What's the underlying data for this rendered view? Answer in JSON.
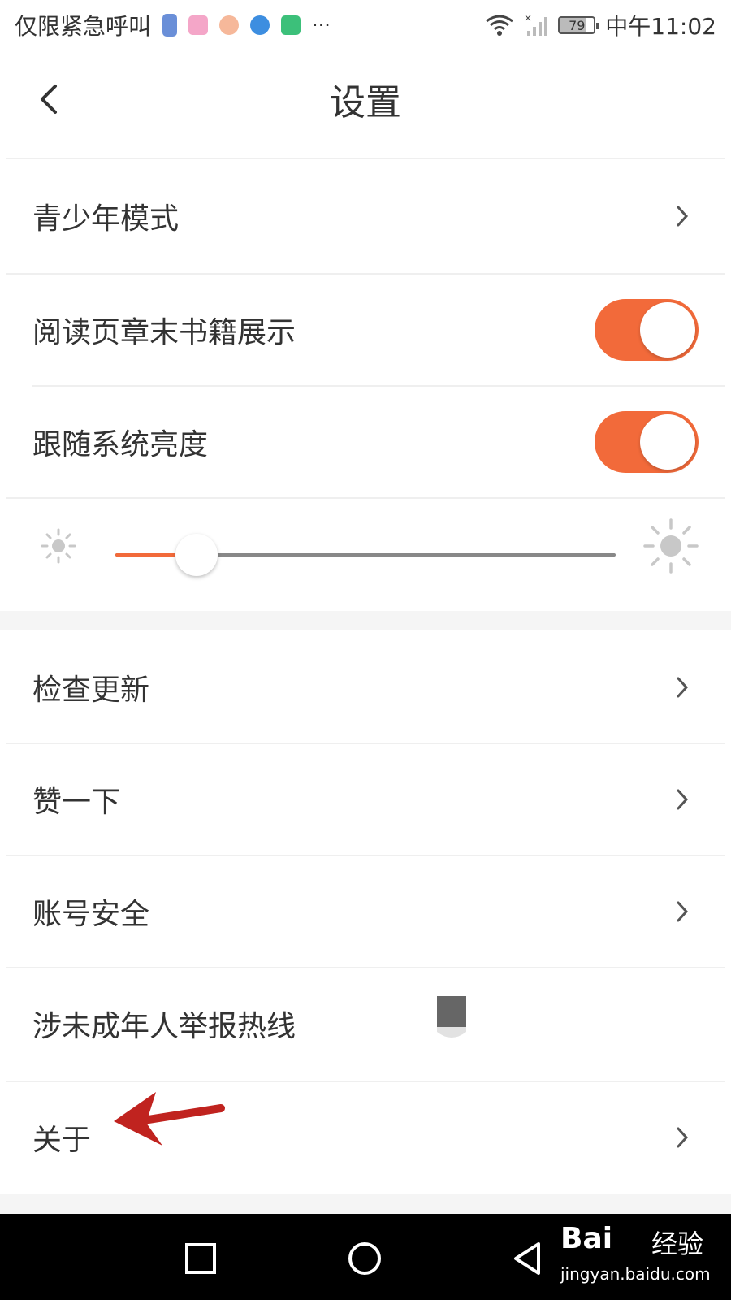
{
  "status_bar": {
    "carrier": "仅限紧急呼叫",
    "battery": "79",
    "time": "中午11:02",
    "more": "···"
  },
  "header": {
    "title": "设置"
  },
  "settings": {
    "teen_mode": "青少年模式",
    "chapter_end_books": "阅读页章末书籍展示",
    "chapter_end_books_on": true,
    "follow_system_brightness": "跟随系统亮度",
    "follow_system_brightness_on": true,
    "brightness_level": 0.12
  },
  "list": {
    "check_update": "检查更新",
    "like": "赞一下",
    "account_security": "账号安全",
    "minor_report": "涉未成年人举报热线",
    "about": "关于"
  },
  "watermark": {
    "brand": "Bai",
    "brand_cn": "经验",
    "url": "jingyan.baidu.com"
  },
  "colors": {
    "accent": "#f26a3a",
    "annotation_arrow": "#c0231f"
  }
}
